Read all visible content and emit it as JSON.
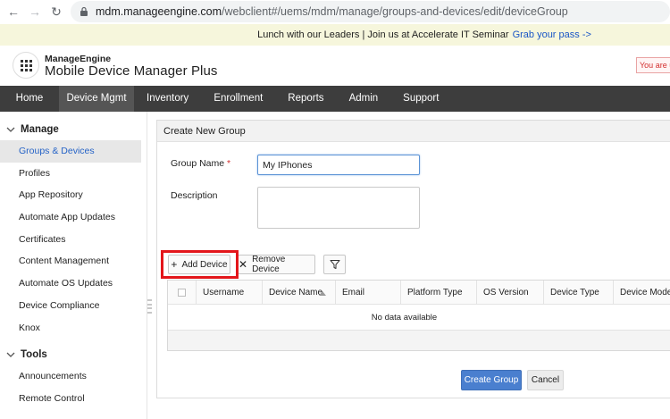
{
  "browser": {
    "url_host": "mdm.manageengine.com",
    "url_path": "/webclient#/uems/mdm/manage/groups-and-devices/edit/deviceGroup"
  },
  "announcement": {
    "text": "Lunch with our Leaders | Join us at Accelerate IT Seminar",
    "link": "Grab your pass ->"
  },
  "header": {
    "brand_small": "ManageEngine",
    "product_name": "Mobile Device Manager Plus",
    "user_notice": "You are us"
  },
  "topnav": {
    "tabs": [
      "Home",
      "Device Mgmt",
      "Inventory",
      "Enrollment",
      "Reports",
      "Admin",
      "Support"
    ],
    "active": "Device Mgmt"
  },
  "sidebar": {
    "manage_label": "Manage",
    "manage_items": [
      "Groups & Devices",
      "Profiles",
      "App Repository",
      "Automate App Updates",
      "Certificates",
      "Content Management",
      "Automate OS Updates",
      "Device Compliance",
      "Knox"
    ],
    "active_item": "Groups & Devices",
    "tools_label": "Tools",
    "tools_items": [
      "Announcements",
      "Remote Control"
    ]
  },
  "form": {
    "title": "Create New Group",
    "group_name_label": "Group Name",
    "required_mark": "*",
    "group_name_value": "My IPhones",
    "description_label": "Description",
    "description_value": ""
  },
  "actions": {
    "add_device": "Add Device",
    "remove_device": "Remove Device"
  },
  "table": {
    "columns": [
      "Username",
      "Device Name",
      "Email",
      "Platform Type",
      "OS Version",
      "Device Type",
      "Device Model"
    ],
    "sorted_column": "Device Name",
    "empty_text": "No data available"
  },
  "footer_buttons": {
    "create": "Create Group",
    "cancel": "Cancel"
  },
  "colors": {
    "accent": "#4a7fcf",
    "nav_bg": "#3d3d3d",
    "highlight": "#e3161b",
    "banner_bg": "#f6f6dc",
    "active_link": "#2563c7"
  }
}
